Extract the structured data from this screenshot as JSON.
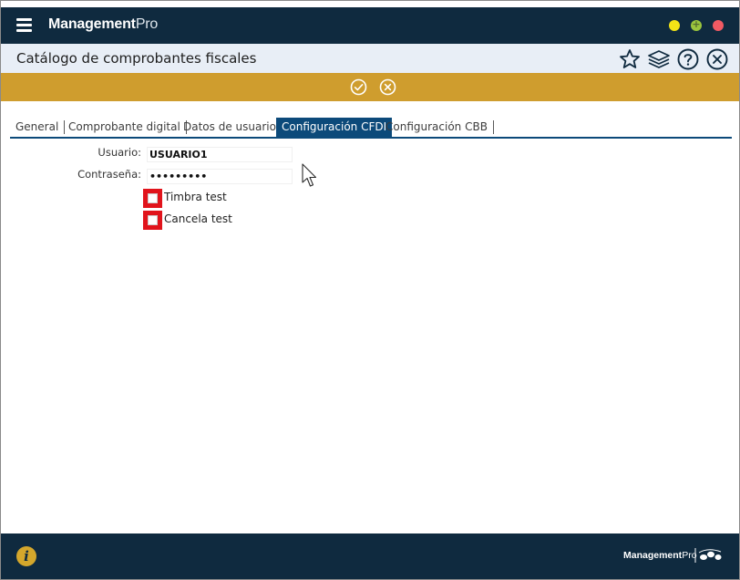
{
  "app": {
    "brand_bold": "Management",
    "brand_light": "Pro"
  },
  "window_controls": [
    {
      "name": "minimize",
      "color": "#f2e316"
    },
    {
      "name": "maximize",
      "color": "#9bc53d",
      "glyph": "+"
    },
    {
      "name": "close",
      "color": "#f05a63"
    }
  ],
  "header": {
    "title": "Catálogo de comprobantes fiscales",
    "icons": [
      "star-icon",
      "layers-icon",
      "help-icon",
      "close-circle-icon"
    ]
  },
  "actionbar": {
    "color": "#cf9d2e",
    "actions": [
      "confirm-icon",
      "cancel-icon"
    ]
  },
  "tabs": [
    {
      "label": "General",
      "active": false
    },
    {
      "label": "Comprobante digital",
      "active": false
    },
    {
      "label": "Datos de usuario",
      "active": false
    },
    {
      "label": "Configuración CFDI",
      "active": true
    },
    {
      "label": "Configuración CBB",
      "active": false
    }
  ],
  "form": {
    "usuario_label": "Usuario:",
    "usuario_value": "USUARIO1",
    "password_label": "Contraseña:",
    "password_value": "•••••••••",
    "timbra_label": "Timbra test",
    "timbra_checked": false,
    "cancela_label": "Cancela test",
    "cancela_checked": false
  },
  "footer": {
    "info_glyph": "i",
    "logo_bold": "Management",
    "logo_light": "Pro"
  },
  "colors": {
    "titlebar": "#0f2a3f",
    "header_bg": "#e8eef6",
    "tab_active": "#0c4a7a",
    "checkbox_highlight": "#e1141c"
  }
}
